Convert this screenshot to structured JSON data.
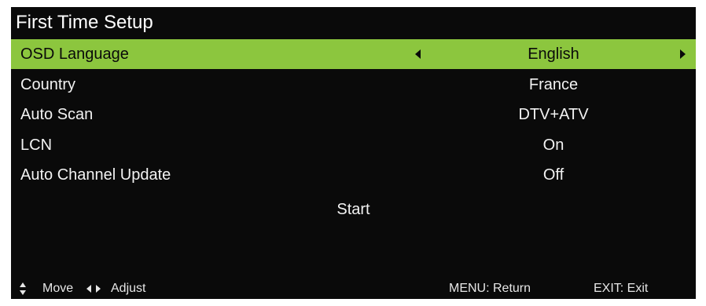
{
  "title": "First Time Setup",
  "rows": [
    {
      "label": "OSD Language",
      "value": "English"
    },
    {
      "label": "Country",
      "value": "France"
    },
    {
      "label": "Auto Scan",
      "value": "DTV+ATV"
    },
    {
      "label": "LCN",
      "value": "On"
    },
    {
      "label": "Auto Channel Update",
      "value": "Off"
    }
  ],
  "start_label": "Start",
  "footer": {
    "move_icon": "up-down-arrows-icon",
    "move": "Move",
    "adjust_icon": "left-right-arrows-icon",
    "adjust": "Adjust",
    "menu": "MENU: Return",
    "exit": "EXIT: Exit"
  },
  "colors": {
    "background": "#0a0a0a",
    "highlight": "#8cc63e",
    "text": "#f2f2f2"
  }
}
